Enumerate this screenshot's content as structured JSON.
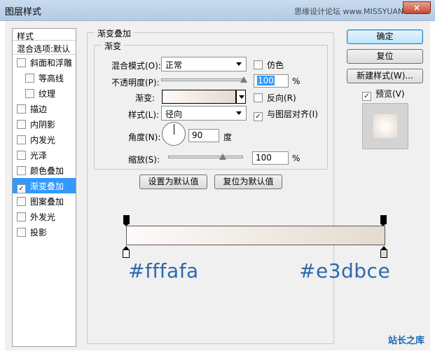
{
  "window": {
    "title": "图层样式",
    "site_text": "思缘设计论坛  www.MISSYUAN.COM",
    "close_label": "×"
  },
  "stylelist": {
    "header": "样式",
    "blend_item": "混合选项:默认",
    "items": [
      {
        "label": "斜面和浮雕",
        "checked": false,
        "sub": false
      },
      {
        "label": "等高线",
        "checked": false,
        "sub": true
      },
      {
        "label": "纹理",
        "checked": false,
        "sub": true
      },
      {
        "label": "描边",
        "checked": false,
        "sub": false
      },
      {
        "label": "内阴影",
        "checked": false,
        "sub": false
      },
      {
        "label": "内发光",
        "checked": false,
        "sub": false
      },
      {
        "label": "光泽",
        "checked": false,
        "sub": false
      },
      {
        "label": "颜色叠加",
        "checked": false,
        "sub": false
      },
      {
        "label": "渐变叠加",
        "checked": true,
        "sub": false,
        "selected": true
      },
      {
        "label": "图案叠加",
        "checked": false,
        "sub": false
      },
      {
        "label": "外发光",
        "checked": false,
        "sub": false
      },
      {
        "label": "投影",
        "checked": false,
        "sub": false
      }
    ]
  },
  "panel": {
    "group_title": "渐变叠加",
    "sub_title": "渐变",
    "blend_mode_label": "混合模式(O):",
    "blend_mode_value": "正常",
    "dither_label": "仿色",
    "opacity_label": "不透明度(P):",
    "opacity_value": "100",
    "opacity_fraction": 1.0,
    "percent": "%",
    "gradient_label": "渐变:",
    "reverse_label": "反向(R)",
    "style_label": "样式(L):",
    "style_value": "径向",
    "align_label": "与图层对齐(I)",
    "angle_label": "角度(N):",
    "angle_value": "90",
    "degree": "度",
    "scale_label": "缩放(S):",
    "scale_value": "100",
    "scale_fraction": 0.73,
    "make_default": "设置为默认值",
    "reset_default": "复位为默认值"
  },
  "buttons": {
    "ok": "确定",
    "reset": "复位",
    "new_style": "新建样式(W)...",
    "preview": "预览(V)"
  },
  "gradient": {
    "left_hex": "#fffafa",
    "right_hex": "#e3dbce",
    "left_color": "#fffafa",
    "right_color": "#e3dbce"
  },
  "watermark": "站长之库"
}
